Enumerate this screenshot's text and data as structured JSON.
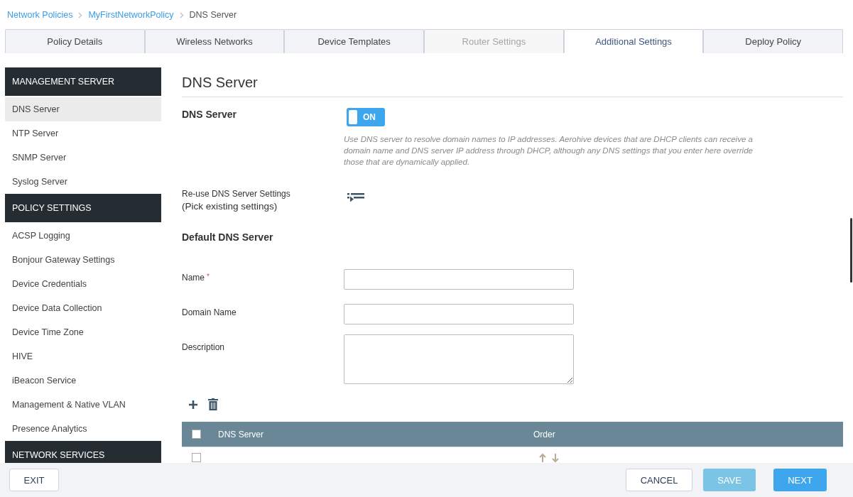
{
  "breadcrumb": [
    {
      "label": "Network Policies",
      "link": true
    },
    {
      "label": "MyFirstNetworkPolicy",
      "link": true
    },
    {
      "label": "DNS Server",
      "link": false
    }
  ],
  "tabs": [
    {
      "label": "Policy Details",
      "selected": false,
      "disabled": false
    },
    {
      "label": "Wireless Networks",
      "selected": false,
      "disabled": false
    },
    {
      "label": "Device Templates",
      "selected": false,
      "disabled": false
    },
    {
      "label": "Router Settings",
      "selected": false,
      "disabled": true
    },
    {
      "label": "Additional Settings",
      "selected": true,
      "disabled": false
    },
    {
      "label": "Deploy Policy",
      "selected": false,
      "disabled": false
    }
  ],
  "sidebar": {
    "sections": [
      {
        "title": "MANAGEMENT SERVER",
        "items": [
          {
            "label": "DNS Server",
            "selected": true
          },
          {
            "label": "NTP Server",
            "selected": false
          },
          {
            "label": "SNMP Server",
            "selected": false
          },
          {
            "label": "Syslog Server",
            "selected": false
          }
        ]
      },
      {
        "title": "POLICY SETTINGS",
        "items": [
          {
            "label": "ACSP Logging",
            "selected": false
          },
          {
            "label": "Bonjour Gateway Settings",
            "selected": false
          },
          {
            "label": "Device Credentials",
            "selected": false
          },
          {
            "label": "Device Data Collection",
            "selected": false
          },
          {
            "label": "Device Time Zone",
            "selected": false
          },
          {
            "label": "HIVE",
            "selected": false
          },
          {
            "label": "iBeacon Service",
            "selected": false
          },
          {
            "label": "Management & Native VLAN",
            "selected": false
          },
          {
            "label": "Presence Analytics",
            "selected": false
          }
        ]
      },
      {
        "title": "NETWORK SERVICES"
      }
    ]
  },
  "content": {
    "title": "DNS Server",
    "dns_toggle": {
      "label": "DNS Server",
      "on": true,
      "text": "ON"
    },
    "description": "Use DNS server to resolve domain names to IP addresses. Aerohive devices that are DHCP clients can receive a domain name and DNS server IP address through DHCP, although any DNS settings that you enter here override those that are dynamically applied.",
    "reuse_label": "Re-use DNS Server Settings",
    "reuse_hint": "(Pick existing settings)",
    "section_title": "Default DNS Server",
    "fields": [
      {
        "label": "Name",
        "required_mark": "*",
        "kind": "input"
      },
      {
        "label": "Domain Name",
        "kind": "input"
      },
      {
        "label": "Description",
        "kind": "textarea"
      }
    ],
    "table": {
      "columns": [
        "DNS Server",
        "Order"
      ],
      "header_checked": false,
      "rows": [
        {
          "checked": false
        }
      ]
    }
  },
  "footer": {
    "exit": "EXIT",
    "cancel": "CANCEL",
    "save": {
      "label": "SAVE",
      "disabled": true
    },
    "next": "NEXT"
  }
}
